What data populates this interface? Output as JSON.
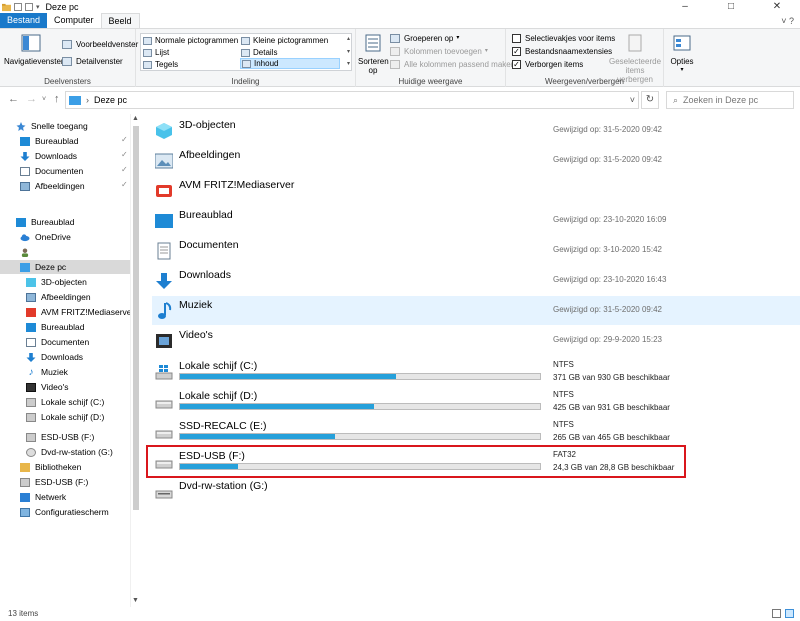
{
  "window": {
    "title": "Deze pc",
    "minimize": "–",
    "maximize": "□",
    "close": "✕",
    "help": "˅ ?"
  },
  "tabs": [
    "Bestand",
    "Computer",
    "Beeld"
  ],
  "ribbon": {
    "deelvensters": {
      "label": "Deelvensters",
      "navigatievenster": "Navigatievenster",
      "voorbeeldvenster": "Voorbeeldvenster",
      "detailvenster": "Detailvenster"
    },
    "indeling": {
      "label": "Indeling",
      "items": [
        "Normale pictogrammen",
        "Kleine pictogrammen",
        "Lijst",
        "Details",
        "Tegels",
        "Inhoud"
      ]
    },
    "huidige_weergave": {
      "label": "Huidige weergave",
      "sorteren": "Sorteren op",
      "groeperen": "Groeperen op",
      "kolommen": "Kolommen toevoegen",
      "passend": "Alle kolommen passend maken"
    },
    "weergeven": {
      "label": "Weergeven/verbergen",
      "selectievakjes": "Selectievakjes voor items",
      "extensies": "Bestandsnaamextensies",
      "verborgen": "Verborgen items",
      "geselecteerde": "Geselecteerde items verbergen",
      "opties": "Opties"
    }
  },
  "address": {
    "path": "Deze pc",
    "search_placeholder": "Zoeken in Deze pc"
  },
  "sidebar": {
    "items": [
      {
        "label": "Snelle toegang"
      },
      {
        "label": "Bureaublad"
      },
      {
        "label": "Downloads"
      },
      {
        "label": "Documenten"
      },
      {
        "label": "Afbeeldingen"
      },
      {
        "label": "Bureaublad"
      },
      {
        "label": "OneDrive"
      },
      {
        "label": ""
      },
      {
        "label": "Deze pc"
      },
      {
        "label": "3D-objecten"
      },
      {
        "label": "Afbeeldingen"
      },
      {
        "label": "AVM FRITZ!Mediaserver"
      },
      {
        "label": "Bureaublad"
      },
      {
        "label": "Documenten"
      },
      {
        "label": "Downloads"
      },
      {
        "label": "Muziek"
      },
      {
        "label": "Video's"
      },
      {
        "label": "Lokale schijf (C:)"
      },
      {
        "label": "Lokale schijf (D:)"
      },
      {
        "label": "ESD-USB (F:)"
      },
      {
        "label": "Dvd-rw-station (G:)"
      },
      {
        "label": "Bibliotheken"
      },
      {
        "label": "ESD-USB (F:)"
      },
      {
        "label": "Netwerk"
      },
      {
        "label": "Configuratiescherm"
      }
    ]
  },
  "content": {
    "folders": [
      {
        "name": "3D-objecten",
        "meta": "Gewijzigd op: 31-5-2020 09:42"
      },
      {
        "name": "Afbeeldingen",
        "meta": "Gewijzigd op: 31-5-2020 09:42"
      },
      {
        "name": "AVM FRITZ!Mediaserver",
        "meta": ""
      },
      {
        "name": "Bureaublad",
        "meta": "Gewijzigd op: 23-10-2020 16:09"
      },
      {
        "name": "Documenten",
        "meta": "Gewijzigd op: 3-10-2020 15:42"
      },
      {
        "name": "Downloads",
        "meta": "Gewijzigd op: 23-10-2020 16:43"
      },
      {
        "name": "Muziek",
        "meta": "Gewijzigd op: 31-5-2020 09:42"
      },
      {
        "name": "Video's",
        "meta": "Gewijzigd op: 29-9-2020 15:23"
      }
    ],
    "drives": [
      {
        "name": "Lokale schijf (C:)",
        "fs": "NTFS",
        "free": "371 GB van 930 GB beschikbaar",
        "used_fraction": 0.6
      },
      {
        "name": "Lokale schijf (D:)",
        "fs": "NTFS",
        "free": "425 GB van 931 GB beschikbaar",
        "used_fraction": 0.54
      },
      {
        "name": "SSD-RECALC (E:)",
        "fs": "NTFS",
        "free": "265 GB van 465 GB beschikbaar",
        "used_fraction": 0.43
      },
      {
        "name": "ESD-USB (F:)",
        "fs": "FAT32",
        "free": "24,3 GB van 28,8 GB beschikbaar",
        "used_fraction": 0.16
      },
      {
        "name": "Dvd-rw-station (G:)",
        "fs": "",
        "free": ""
      }
    ]
  },
  "status": {
    "count": "13 items"
  },
  "colors": {
    "accent": "#1979ca",
    "bar_fill": "#26a0da",
    "highlight": "#d9161c"
  }
}
